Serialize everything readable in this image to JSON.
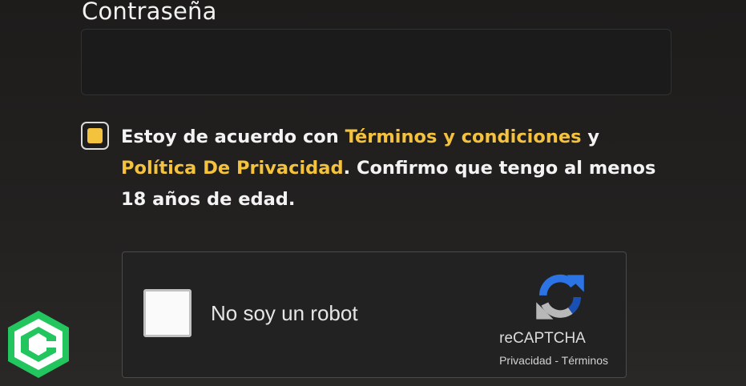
{
  "form": {
    "password_label": "Contraseña",
    "password_value": "",
    "terms": {
      "checked": true,
      "text_prefix": "Estoy de acuerdo con ",
      "terms_link": "Términos y condiciones",
      "text_and": " y ",
      "privacy_link": "Política De Privacidad",
      "text_suffix": ". Confirmo que tengo al menos 18 años de edad."
    }
  },
  "recaptcha": {
    "checked": false,
    "label": "No soy un robot",
    "brand": "reCAPTCHA",
    "privacy_link": "Privacidad",
    "separator": " - ",
    "terms_link": "Términos"
  },
  "icons": {
    "recaptcha_logo": "recaptcha-logo-icon",
    "corner_badge": "c-hexagon-logo-icon"
  },
  "colors": {
    "accent": "#f5c23d",
    "background": "#1f1e1d",
    "input_background": "#1b1b1c",
    "badge_green": "#22c55e"
  }
}
